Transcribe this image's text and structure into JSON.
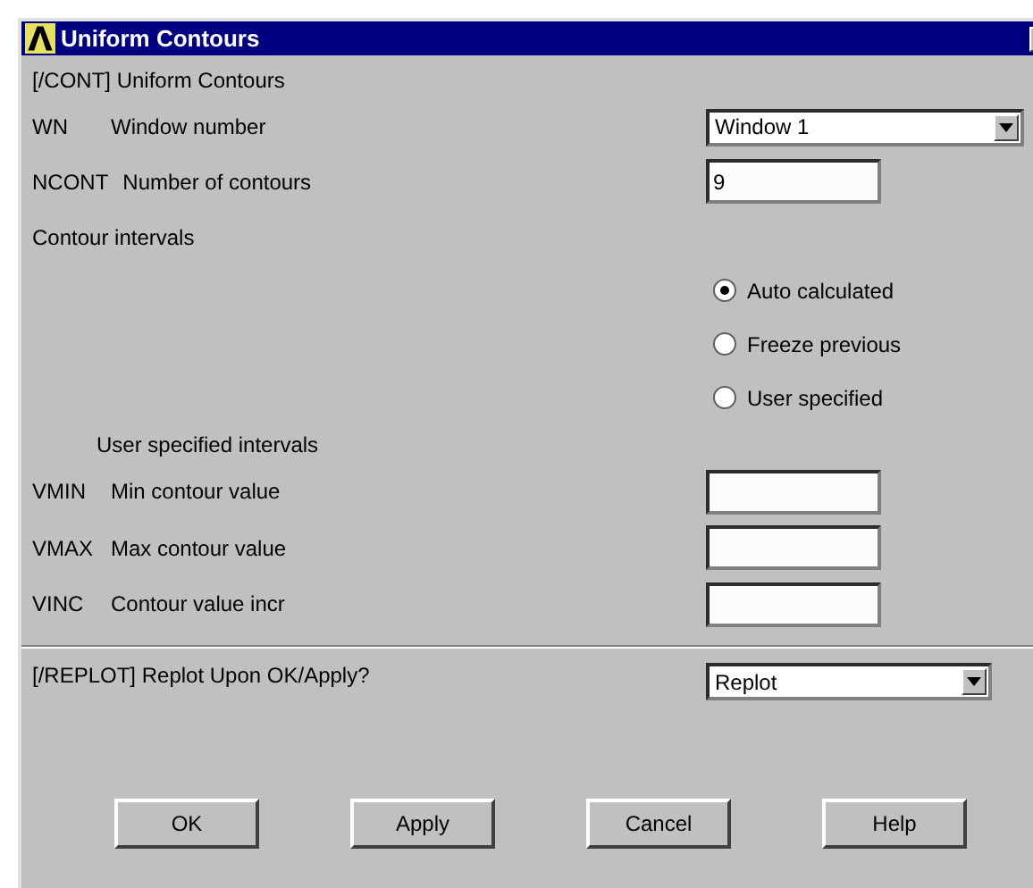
{
  "window": {
    "title": "Uniform Contours"
  },
  "heading": "[/CONT]  Uniform Contours",
  "rows": [
    {
      "kind": "dropdown",
      "code": "WN",
      "label": "Window number",
      "value": "Window 1"
    },
    {
      "kind": "text",
      "code": "NCONT",
      "label": "Number of contours",
      "value": "9"
    },
    {
      "kind": "radios",
      "label": "Contour intervals",
      "options": [
        {
          "label": "Auto calculated",
          "selected": true
        },
        {
          "label": "Freeze previous",
          "selected": false
        },
        {
          "label": "User specified",
          "selected": false
        }
      ]
    },
    {
      "kind": "subheading",
      "label": "User specified intervals"
    },
    {
      "kind": "text",
      "code": "VMIN",
      "label": "Min contour value"
    },
    {
      "kind": "text",
      "code": "VMAX",
      "label": "Max contour value"
    },
    {
      "kind": "text",
      "code": "VINC",
      "label": "Contour value incr"
    }
  ],
  "replot": {
    "label": "[/REPLOT]  Replot Upon OK/Apply?",
    "value": "Replot"
  },
  "buttons": [
    "OK",
    "Apply",
    "Cancel",
    "Help"
  ]
}
